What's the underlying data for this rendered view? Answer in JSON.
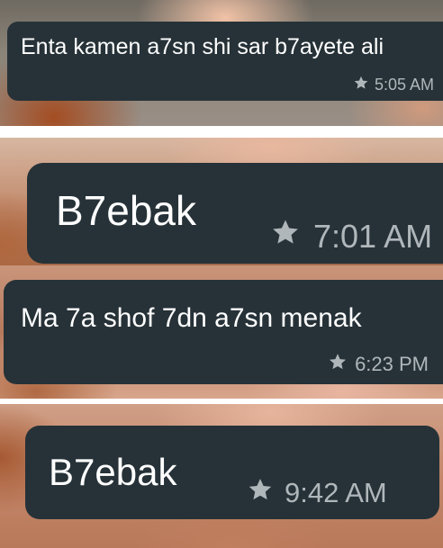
{
  "messages": [
    {
      "text": "Enta kamen a7sn shi sar b7ayete ali",
      "time": "5:05 AM",
      "starred": true,
      "icon": "star-icon"
    },
    {
      "text": "B7ebak",
      "time": "7:01 AM",
      "starred": true,
      "icon": "star-icon"
    },
    {
      "text": "Ma 7a shof 7dn a7sn menak",
      "time": "6:23 PM",
      "starred": true,
      "icon": "star-icon"
    },
    {
      "text": "B7ebak",
      "time": "9:42 AM",
      "starred": true,
      "icon": "star-icon"
    }
  ],
  "colors": {
    "bubble": "#263238",
    "text": "#ffffff",
    "meta": "#b0b7bb",
    "divider": "#ffffff"
  }
}
